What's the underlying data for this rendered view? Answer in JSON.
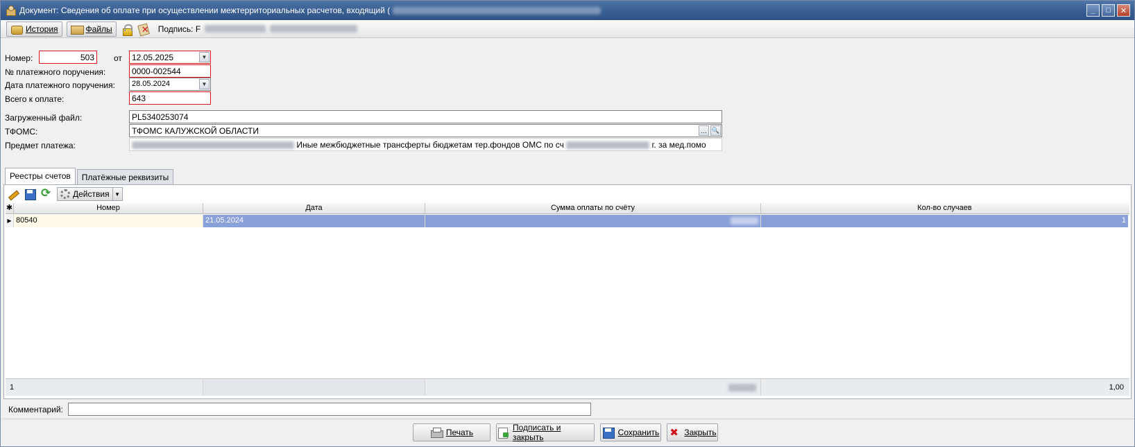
{
  "window": {
    "title": "Документ: Сведения об оплате при осуществлении межтерриториальных расчетов, входящий ("
  },
  "toolbar": {
    "history_label": "История",
    "files_label": "Файлы",
    "sign_label": "Подпись: F"
  },
  "form": {
    "number_label": "Номер:",
    "number_value": "503",
    "from_label": "от",
    "date_value": "12.05.2025",
    "payorder_num_label": "№ платежного поручения:",
    "payorder_num_value": "0000-002544",
    "payorder_date_label": "Дата платежного поручения:",
    "payorder_date_value": "28.05.2024",
    "total_label": "Всего к оплате:",
    "total_value": "643",
    "loaded_file_label": "Загруженный файл:",
    "loaded_file_value": "PL5340253074",
    "tfoms_label": "ТФОМС:",
    "tfoms_value": "ТФОМС КАЛУЖСКОЙ ОБЛАСТИ",
    "subject_label": "Предмет платежа:",
    "subject_value_part1": "Иные межбюджетные трансферты бюджетам тер.фондов  ОМС по сч",
    "subject_value_part2": "г. за мед.помо"
  },
  "tabs": [
    {
      "label": "Реестры счетов",
      "active": true
    },
    {
      "label": "Платёжные реквизиты",
      "active": false
    }
  ],
  "grid_toolbar": {
    "actions_label": "Действия"
  },
  "grid": {
    "columns": [
      "Номер",
      "Дата",
      "Сумма оплаты по счёту",
      "Кол-во случаев"
    ],
    "rows": [
      {
        "number": "80540",
        "date": "21.05.2024",
        "amount": "",
        "cases": "1"
      }
    ],
    "footer": {
      "count": "1",
      "cases_total": "1,00"
    }
  },
  "comment": {
    "label": "Комментарий:",
    "value": ""
  },
  "buttons": {
    "print": "Печать",
    "sign_close": "Подписать и закрыть",
    "save": "Сохранить",
    "close": "Закрыть"
  },
  "colors": {
    "selected_row": "#8aa0d9",
    "required_border": "#e0121b"
  }
}
